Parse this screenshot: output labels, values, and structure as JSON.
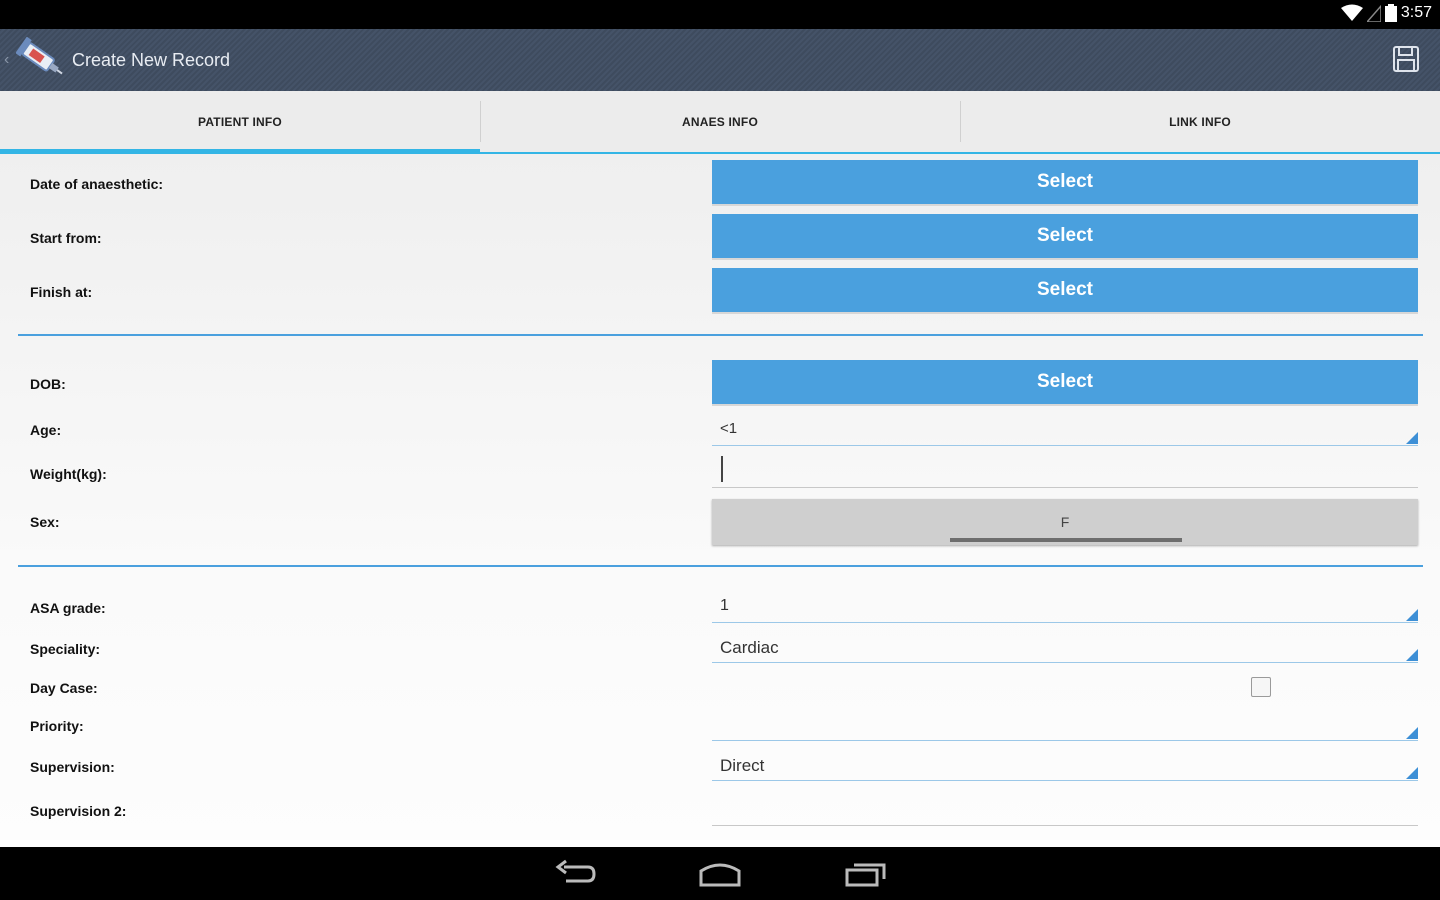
{
  "status_bar": {
    "time": "3:57"
  },
  "action_bar": {
    "title": "Create New Record"
  },
  "tabs": [
    {
      "label": "PATIENT INFO",
      "active": true
    },
    {
      "label": "ANAES INFO",
      "active": false
    },
    {
      "label": "LINK INFO",
      "active": false
    }
  ],
  "form": {
    "date_of_anaesthetic": {
      "label": "Date of anaesthetic:",
      "button": "Select"
    },
    "start_from": {
      "label": "Start from:",
      "button": "Select"
    },
    "finish_at": {
      "label": "Finish at:",
      "button": "Select"
    },
    "dob": {
      "label": "DOB:",
      "button": "Select"
    },
    "age": {
      "label": "Age:",
      "value": "<1"
    },
    "weight": {
      "label": "Weight(kg):",
      "value": ""
    },
    "sex": {
      "label": "Sex:",
      "value": "F"
    },
    "asa_grade": {
      "label": "ASA grade:",
      "value": "1"
    },
    "speciality": {
      "label": "Speciality:",
      "value": "Cardiac"
    },
    "day_case": {
      "label": "Day Case:",
      "checked": false
    },
    "priority": {
      "label": "Priority:",
      "value": ""
    },
    "supervision": {
      "label": "Supervision:",
      "value": "Direct"
    },
    "supervision_2": {
      "label": "Supervision 2:",
      "value": ""
    }
  },
  "colors": {
    "accent": "#4aa0de",
    "tab_indicator": "#33b5e5",
    "action_bar": "#424f63"
  },
  "icons": {
    "app": "syringe-icon",
    "save": "floppy-disk-icon",
    "back": "back-icon",
    "home": "home-icon",
    "recents": "recents-icon"
  }
}
